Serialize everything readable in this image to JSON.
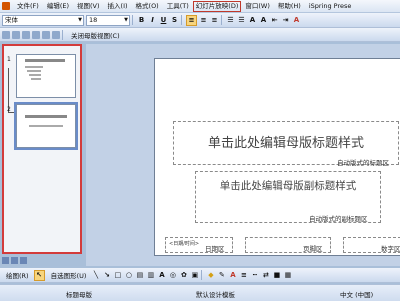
{
  "menubar": {
    "items": [
      "文件(F)",
      "编辑(E)",
      "视图(V)",
      "插入(I)",
      "格式(O)",
      "工具(T)",
      "幻灯片放映(D)",
      "窗口(W)",
      "帮助(H)",
      "iSpring Prese"
    ],
    "active_index": 6
  },
  "format_toolbar": {
    "font_name": "宋体",
    "font_size": "18",
    "bold": "B",
    "italic": "I",
    "underline": "U",
    "shadow": "S"
  },
  "master_toolbar": {
    "close_master_label": "关闭母版视图(C)"
  },
  "thumbnails": [
    "1",
    "2"
  ],
  "slide": {
    "title_placeholder": "单击此处编辑母版标题样式",
    "title_area_label": "自动版式的标题区",
    "subtitle_placeholder": "单击此处编辑母版副标题样式",
    "subtitle_area_label": "自动版式的副标题区",
    "date_field": "<日期/时间>",
    "date_area_label": "日期区",
    "footer_area_label": "页脚区",
    "number_area_label": "数字区"
  },
  "drawing_toolbar": {
    "draw_label": "绘图(R)",
    "autoshapes_label": "自选图形(U)"
  },
  "statusbar": {
    "view": "标题母版",
    "design": "默认设计模板",
    "language": "中文 (中国)"
  }
}
